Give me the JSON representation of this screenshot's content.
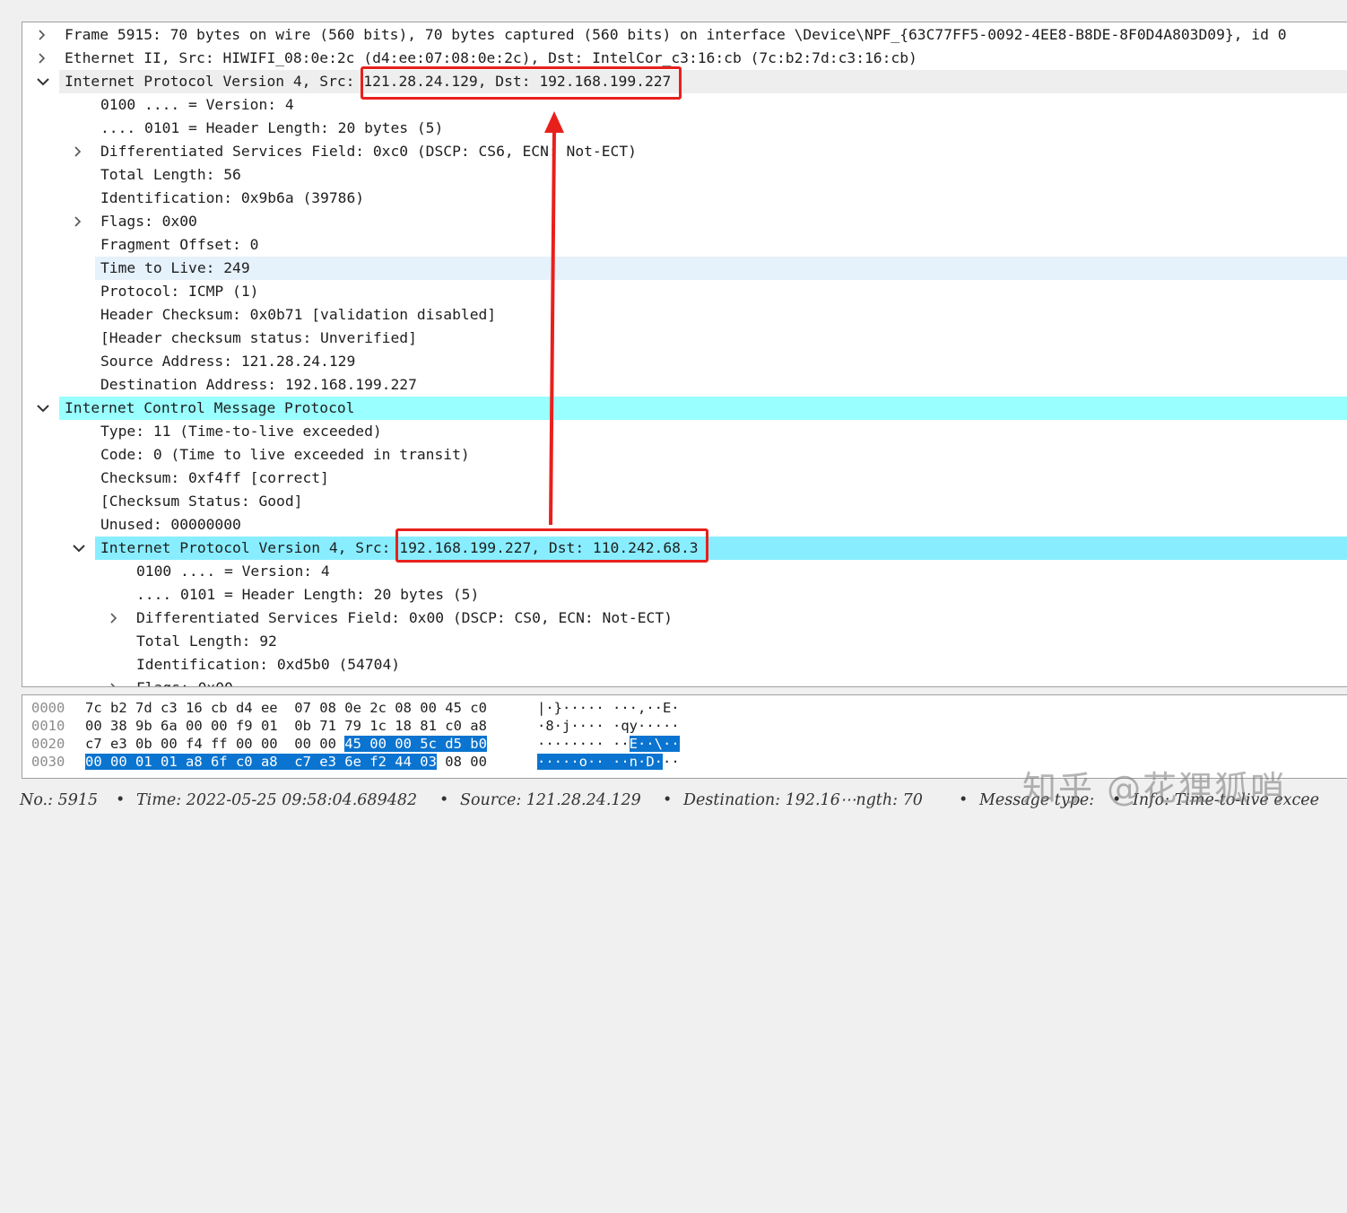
{
  "tree_rows": [
    {
      "text": "Frame 5915: 70 bytes on wire (560 bits), 70 bytes captured (560 bits) on interface \\Device\\NPF_{63C77FF5-0092-4EE8-B8DE-8F0D4A803D09}, id 0",
      "expander": "collapsed"
    },
    {
      "text": "Ethernet II, Src: HIWIFI_08:0e:2c (d4:ee:07:08:0e:2c), Dst: IntelCor_c3:16:cb (7c:b2:7d:c3:16:cb)",
      "expander": "collapsed"
    },
    {
      "text": "Internet Protocol Version 4, Src: 121.28.24.129, Dst: 192.168.199.227",
      "expander": "expanded",
      "highlight": "grey"
    },
    {
      "text": "0100 .... = Version: 4",
      "expander": "none"
    },
    {
      "text": ".... 0101 = Header Length: 20 bytes (5)",
      "expander": "none"
    },
    {
      "text": "Differentiated Services Field: 0xc0 (DSCP: CS6, ECN: Not-ECT)",
      "expander": "collapsed"
    },
    {
      "text": "Total Length: 56",
      "expander": "none"
    },
    {
      "text": "Identification: 0x9b6a (39786)",
      "expander": "none"
    },
    {
      "text": "Flags: 0x00",
      "expander": "collapsed"
    },
    {
      "text": "Fragment Offset: 0",
      "expander": "none"
    },
    {
      "text": "Time to Live: 249",
      "expander": "none",
      "highlight": "light"
    },
    {
      "text": "Protocol: ICMP (1)",
      "expander": "none"
    },
    {
      "text": "Header Checksum: 0x0b71 [validation disabled]",
      "expander": "none"
    },
    {
      "text": "[Header checksum status: Unverified]",
      "expander": "none"
    },
    {
      "text": "Source Address: 121.28.24.129",
      "expander": "none"
    },
    {
      "text": "Destination Address: 192.168.199.227",
      "expander": "none"
    },
    {
      "text": "Internet Control Message Protocol",
      "expander": "expanded",
      "highlight": "cyan"
    },
    {
      "text": "Type: 11 (Time-to-live exceeded)",
      "expander": "none"
    },
    {
      "text": "Code: 0 (Time to live exceeded in transit)",
      "expander": "none"
    },
    {
      "text": "Checksum: 0xf4ff [correct]",
      "expander": "none"
    },
    {
      "text": "[Checksum Status: Good]",
      "expander": "none"
    },
    {
      "text": "Unused: 00000000",
      "expander": "none"
    },
    {
      "text": "Internet Protocol Version 4, Src: 192.168.199.227, Dst: 110.242.68.3",
      "expander": "expanded",
      "highlight": "cyan2"
    },
    {
      "text": "0100 .... = Version: 4",
      "expander": "none"
    },
    {
      "text": ".... 0101 = Header Length: 20 bytes (5)",
      "expander": "none"
    },
    {
      "text": "Differentiated Services Field: 0x00 (DSCP: CS0, ECN: Not-ECT)",
      "expander": "collapsed"
    },
    {
      "text": "Total Length: 92",
      "expander": "none"
    },
    {
      "text": "Identification: 0xd5b0 (54704)",
      "expander": "none"
    },
    {
      "text": "Flags: 0x00",
      "expander": "collapsed"
    }
  ],
  "hex_rows": [
    {
      "offset": "0000",
      "bytes_a": "7c b2 7d c3 16 cb d4 ee  07 08 0e 2c 08 00 45 c0",
      "bytes_sel": "",
      "bytes_b": "",
      "ascii_a": "|·}····· ···,··E·",
      "ascii_sel": "",
      "ascii_b": ""
    },
    {
      "offset": "0010",
      "bytes_a": "00 38 9b 6a 00 00 f9 01  0b 71 79 1c 18 81 c0 a8",
      "bytes_sel": "",
      "bytes_b": "",
      "ascii_a": "·8·j···· ·qy·····",
      "ascii_sel": "",
      "ascii_b": ""
    },
    {
      "offset": "0020",
      "bytes_a": "c7 e3 0b 00 f4 ff 00 00  00 00 ",
      "bytes_sel": "45 00 00 5c d5 b0",
      "bytes_b": "",
      "ascii_a": "········ ··",
      "ascii_sel": "E··\\··",
      "ascii_b": ""
    },
    {
      "offset": "0030",
      "bytes_a": "",
      "bytes_sel": "00 00 01 01 a8 6f c0 a8  c7 e3 6e f2 44 03",
      "bytes_b": " 08 00",
      "ascii_a": "",
      "ascii_sel": "·····o·· ··n·D·",
      "ascii_b": "··"
    }
  ],
  "status_bar": {
    "no": "No.: 5915",
    "time": "Time: 2022-05-25 09:58:04.689482",
    "source": "Source: 121.28.24.129",
    "destination": "Destination: 192.16⋯ngth: 70",
    "message": "Message type:",
    "info": "Info: Time-to-live excee",
    "sep": "•"
  },
  "watermark": "知乎 @花狸狐哨",
  "colors": {
    "highlight_box": "#e8201c",
    "arrow": "#e8201c",
    "selection": "#0a74d0",
    "cyan": "#99ffff"
  }
}
